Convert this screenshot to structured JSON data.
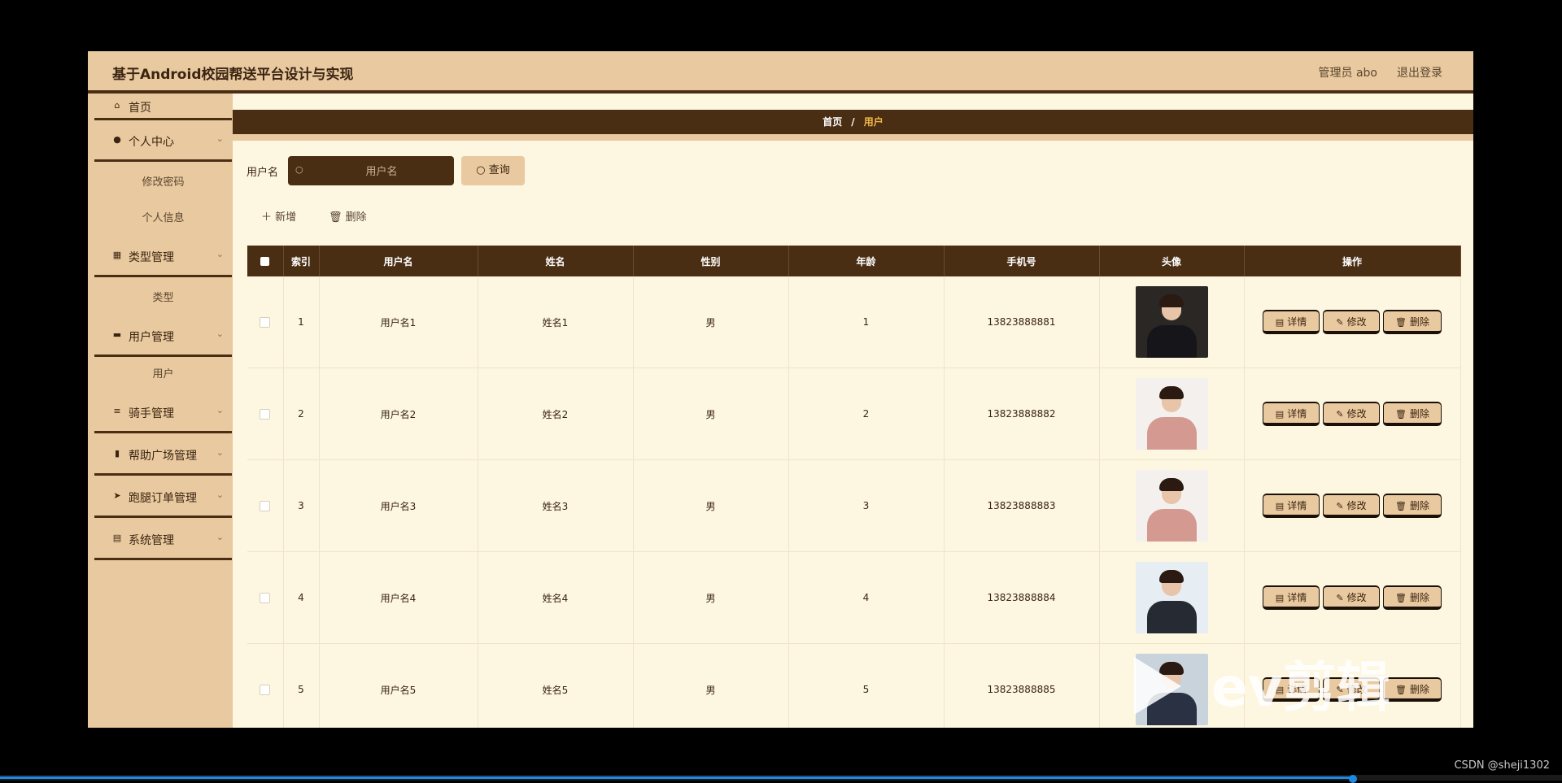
{
  "header": {
    "title": "基于Android校园帮送平台设计与实现",
    "admin": "管理员 abo",
    "logout": "退出登录"
  },
  "sidebar": {
    "home": "首页",
    "personal_center": "个人中心",
    "change_password": "修改密码",
    "personal_info": "个人信息",
    "type_mgmt": "类型管理",
    "type": "类型",
    "user_mgmt": "用户管理",
    "user": "用户",
    "rider_mgmt": "骑手管理",
    "help_square_mgmt": "帮助广场管理",
    "errand_order_mgmt": "跑腿订单管理",
    "system_mgmt": "系统管理"
  },
  "breadcrumb": {
    "home": "首页",
    "separator": "/",
    "current": "用户"
  },
  "search": {
    "label": "用户名",
    "placeholder": "用户名",
    "button": "查询"
  },
  "toolbar": {
    "add": "新增",
    "delete": "删除"
  },
  "table": {
    "columns": [
      "索引",
      "用户名",
      "姓名",
      "性别",
      "年龄",
      "手机号",
      "头像",
      "操作"
    ],
    "rows": [
      {
        "index": "1",
        "username": "用户名1",
        "name": "姓名1",
        "gender": "男",
        "age": "1",
        "phone": "13823888881"
      },
      {
        "index": "2",
        "username": "用户名2",
        "name": "姓名2",
        "gender": "男",
        "age": "2",
        "phone": "13823888882"
      },
      {
        "index": "3",
        "username": "用户名3",
        "name": "姓名3",
        "gender": "男",
        "age": "3",
        "phone": "13823888883"
      },
      {
        "index": "4",
        "username": "用户名4",
        "name": "姓名4",
        "gender": "男",
        "age": "4",
        "phone": "13823888884"
      },
      {
        "index": "5",
        "username": "用户名5",
        "name": "姓名5",
        "gender": "男",
        "age": "5",
        "phone": "13823888885"
      }
    ],
    "actions": {
      "detail": "详情",
      "edit": "修改",
      "delete": "删除"
    }
  },
  "overlay": {
    "watermark": "ev剪辑",
    "credit": "CSDN @sheji1302"
  },
  "colors": {
    "dark_brown": "#4a2e14",
    "tan": "#e9c99f",
    "cream": "#fdf6e0",
    "accent_gold": "#f0b84a"
  },
  "video_progress": 0.866
}
